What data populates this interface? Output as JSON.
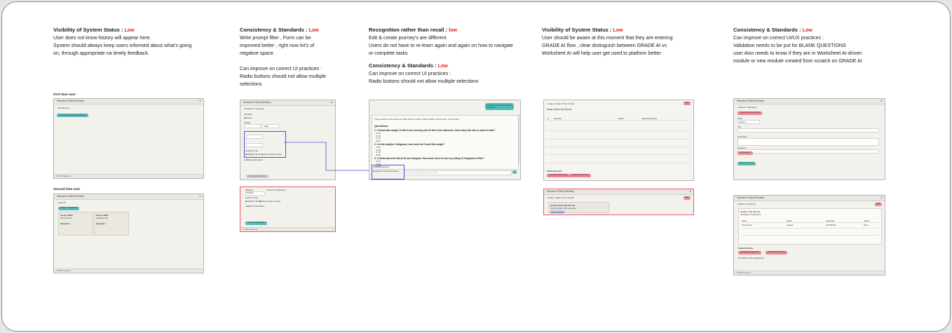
{
  "notes": [
    {
      "heading": "Visibility of System Status :",
      "severity": "Low",
      "lines": [
        "User does not know history will appear here.",
        "System should always keep users informed about what's going",
        "on, through appropriate na timely feedback."
      ]
    },
    {
      "heading": "Consistency & Standards :",
      "severity": "Low",
      "lines": [
        "Write prompt filter , Form can be",
        "improved better , right now lot's of",
        "negative space."
      ],
      "extra_lines": [
        "Can improve on correct UI practices :",
        "Radio buttons should not allow multiple",
        "selections"
      ]
    },
    {
      "heading": "Recognition rather than recall :",
      "severity": "low",
      "lines": [
        "Edit & create journey's are different.",
        "Users do not have to re-learn again and again on how to navigate",
        "or complete tasks"
      ],
      "heading2": "Consistency & Standards :",
      "severity2": "Low",
      "lines2": [
        "Can improve on correct UI practices :",
        "Radio buttons should not allow multiple selections"
      ]
    },
    {
      "heading": "Visibility of System Status :",
      "severity": "Low",
      "lines": [
        "User should be aware at this moment that they are entering",
        "GRADE AI flow , clear distinguish between GRADE AI vs",
        "Worksheet AI will help user get used to platform better"
      ]
    },
    {
      "heading": "Consistency & Standards :",
      "severity": "Low",
      "lines": [
        "Can improve on correct UI/UX practices :",
        "Validation needs to be put for BLANK QUESTIONS",
        "user Also needs to know if they are in Worksheet AI-driven",
        "module or new module created from scratch on GRADE AI"
      ]
    }
  ],
  "labels": {
    "first_time": "First time user",
    "second_time": "Second time user"
  },
  "shots": {
    "window_title": "Sarvam AI Gaia (Preview)",
    "a1": {
      "crumb": "Worksheet AI",
      "button": "Get prompt/Generate Worksheet",
      "footer": "© 2024 Sarvam.ai"
    },
    "a2": {
      "crumb": "Grade AI",
      "button": "Grade AI Worksheet",
      "card1_title": "Grade 3 Math",
      "card1_sub": "The Tree Line",
      "card2_title": "Grade 4 Math",
      "card2_sub": "Fractions 101",
      "q_label": "Question 1",
      "q_text": "A fisherman caught 25 fish in the morning, how many fish?",
      "footer": "© 2024 Sarvam.ai"
    },
    "b1": {
      "crumb": "Worksheet / Generate",
      "field1": "Standard",
      "field2": "Subject",
      "label1": "Grade",
      "label2": "Math",
      "section": "Question Type",
      "opt1": "Multiple Choice",
      "opt2": "Short Answer",
      "opt3": "Essay",
      "additional": "Additional Information",
      "button": "Generate Worksheet"
    },
    "b2": {
      "label1": "Difficulty",
      "label2": "Number of Questions",
      "val1": "Medium",
      "section": "Question Type",
      "opt1": "Multiple Choice",
      "opt2": "Short Answer",
      "opt3": "Essay",
      "additional": "Additional Information",
      "button": "Generate Worksheet",
      "footer": "© 2024 Sarvam.ai"
    },
    "c": {
      "bubble": "I'd need a worksheet on fishing & fractions",
      "intro": "These questions are designed to align with the Grade 3 Math syllabus and the topic 'The Fish Hat'.",
      "heading": "Questions",
      "q1": "1. A fisherman caught 10 fish in the morning and 20 fish in the afternoon. How many fish did he catch in total?",
      "q2": "2. If a fish weighs 2 kilograms, how much do 5 such fish weigh?",
      "q3": "3. A fisherman sells fish at $2 per kilogram. How much does he earn by selling 10 kilograms of fish?",
      "opts": [
        "a) 20",
        "b) 30",
        "c) 40",
        "d) 50"
      ],
      "sub": "Additional Requests",
      "input": "Type your question or request here",
      "send": "➤"
    },
    "d1": {
      "crumb": "Grade / Grade 3 The Fish Hat",
      "badge": "Edit",
      "title": "Grade 3 book: The fish hat",
      "col1": "#",
      "col2": "Question",
      "col3": "Points",
      "col4": "Expected Answer",
      "results": "Student Results",
      "b1": "Grade/Edit Answer Key",
      "b2": "Upload Student Work"
    },
    "d2": {
      "crumb": "Grade / Grade 3 The Fish Hat",
      "badge": "Edit",
      "title": "Grade 3 book: The fish hat",
      "sub": "Student Work: 3/24 Uploaded",
      "link": "View All Results"
    },
    "e1": {
      "crumb": "Grade AI / Worksheet",
      "button": "Create New Question Set",
      "f1": "Class",
      "f2": "Title",
      "f3": "Grade 3",
      "f4": "Description",
      "f5": "Question 1",
      "pink": "Add Question",
      "teal": "Save & Continue"
    },
    "e2": {
      "crumb": "Grade / The fish hat",
      "badge": "Edit",
      "title": "Grade 3: The fish hat",
      "meta": "Worksheet: 8 questions",
      "col1": "Name",
      "col2": "Grade",
      "col3": "Uploaded",
      "col4": "Status",
      "row": "Priya Kumar",
      "rowg": "Graded",
      "rowd": "12/04/2024",
      "rows": "Done",
      "results": "Student Results",
      "b1": "Grade/Edit Answer Key",
      "b2": "Upload Student Work",
      "sub2": "No student work uploaded yet",
      "footer": "© 2024 Sarvam.ai"
    }
  },
  "colors": {
    "low": "#e02020",
    "teal": "#5bbcb6",
    "pink": "#e98a96",
    "highlight": "#5b4ad6",
    "red_border": "#e85a6a"
  }
}
